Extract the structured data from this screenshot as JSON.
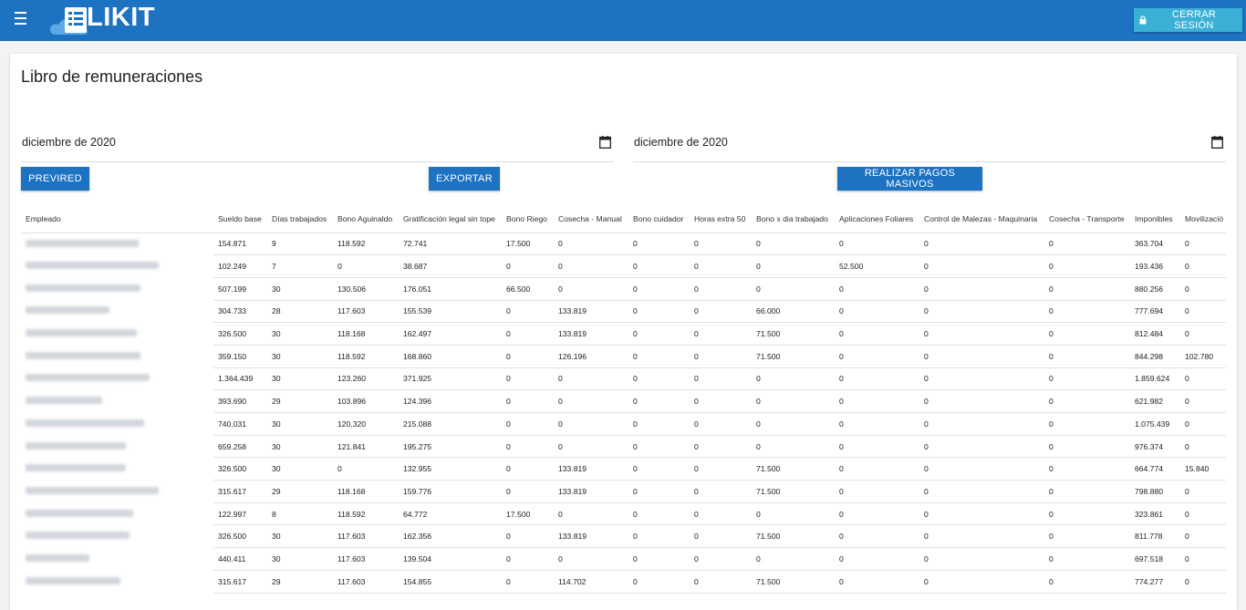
{
  "header": {
    "logo_text": "LIKIT",
    "logout_label": "CERRAR SESIÓN",
    "colors": {
      "bar": "#1d72c2",
      "logout": "#3bb0d6"
    }
  },
  "main": {
    "title": "Libro de remuneraciones",
    "date_from": "diciembre de 2020",
    "date_to": "diciembre de 2020",
    "buttons": {
      "previred": "PREVIRED",
      "exportar": "EXPORTAR",
      "pagos": "REALIZAR PAGOS MASIVOS"
    }
  },
  "table": {
    "columns": [
      "Empleado",
      "Sueldo base",
      "Días trabajados",
      "Bono Aguinaldo",
      "Gratificación legal sin tope",
      "Bono Riego",
      "Cosecha - Manual",
      "Bono cuidador",
      "Horas extra 50",
      "Bono x dia trabajado",
      "Aplicaciones Foliares",
      "Control de Malezas - Maquinaria",
      "Cosecha - Transporte",
      "Imponibles",
      "Movilizació"
    ],
    "rows": [
      [
        "154.871",
        "9",
        "118.592",
        "72.741",
        "17.500",
        "0",
        "0",
        "0",
        "0",
        "0",
        "0",
        "0",
        "363.704",
        "0"
      ],
      [
        "102.249",
        "7",
        "0",
        "38.687",
        "0",
        "0",
        "0",
        "0",
        "0",
        "52.500",
        "0",
        "0",
        "193.436",
        "0"
      ],
      [
        "507.199",
        "30",
        "130.506",
        "176.051",
        "66.500",
        "0",
        "0",
        "0",
        "0",
        "0",
        "0",
        "0",
        "880.256",
        "0"
      ],
      [
        "304.733",
        "28",
        "117.603",
        "155.539",
        "0",
        "133.819",
        "0",
        "0",
        "66.000",
        "0",
        "0",
        "0",
        "777.694",
        "0"
      ],
      [
        "326.500",
        "30",
        "118.168",
        "162.497",
        "0",
        "133.819",
        "0",
        "0",
        "71.500",
        "0",
        "0",
        "0",
        "812.484",
        "0"
      ],
      [
        "359.150",
        "30",
        "118.592",
        "168.860",
        "0",
        "126.196",
        "0",
        "0",
        "71.500",
        "0",
        "0",
        "0",
        "844.298",
        "102.780"
      ],
      [
        "1.364.439",
        "30",
        "123.260",
        "371.925",
        "0",
        "0",
        "0",
        "0",
        "0",
        "0",
        "0",
        "0",
        "1.859.624",
        "0"
      ],
      [
        "393.690",
        "29",
        "103.896",
        "124.396",
        "0",
        "0",
        "0",
        "0",
        "0",
        "0",
        "0",
        "0",
        "621.982",
        "0"
      ],
      [
        "740.031",
        "30",
        "120.320",
        "215.088",
        "0",
        "0",
        "0",
        "0",
        "0",
        "0",
        "0",
        "0",
        "1.075.439",
        "0"
      ],
      [
        "659.258",
        "30",
        "121.841",
        "195.275",
        "0",
        "0",
        "0",
        "0",
        "0",
        "0",
        "0",
        "0",
        "976.374",
        "0"
      ],
      [
        "326.500",
        "30",
        "0",
        "132.955",
        "0",
        "133.819",
        "0",
        "0",
        "71.500",
        "0",
        "0",
        "0",
        "664.774",
        "15.840"
      ],
      [
        "315.617",
        "29",
        "118.168",
        "159.776",
        "0",
        "133.819",
        "0",
        "0",
        "71.500",
        "0",
        "0",
        "0",
        "798.880",
        "0"
      ],
      [
        "122.997",
        "8",
        "118.592",
        "64.772",
        "17.500",
        "0",
        "0",
        "0",
        "0",
        "0",
        "0",
        "0",
        "323.861",
        "0"
      ],
      [
        "326.500",
        "30",
        "117.603",
        "162.356",
        "0",
        "133.819",
        "0",
        "0",
        "71.500",
        "0",
        "0",
        "0",
        "811.778",
        "0"
      ],
      [
        "440.411",
        "30",
        "117.603",
        "139.504",
        "0",
        "0",
        "0",
        "0",
        "0",
        "0",
        "0",
        "0",
        "697.518",
        "0"
      ],
      [
        "315.617",
        "29",
        "117.603",
        "154.855",
        "0",
        "114.702",
        "0",
        "0",
        "71.500",
        "0",
        "0",
        "0",
        "774.277",
        "0"
      ]
    ]
  }
}
